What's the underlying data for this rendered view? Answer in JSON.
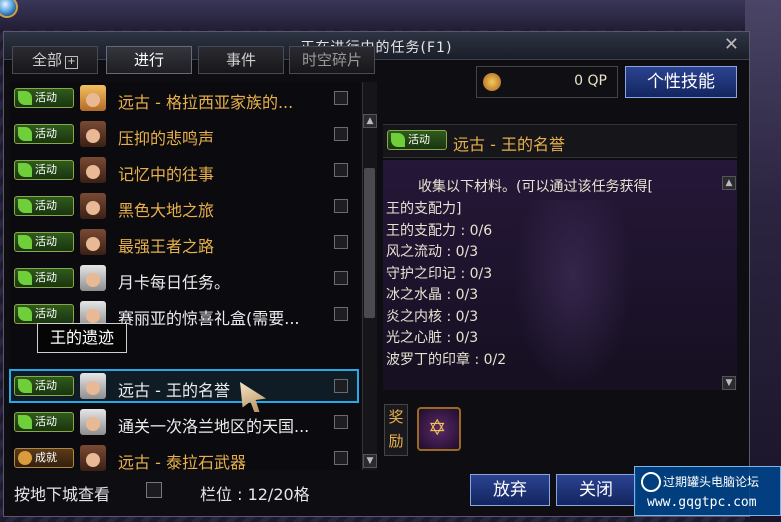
{
  "window": {
    "title": "正在进行中的任务(F1)",
    "close_icon": "close-icon"
  },
  "tabs": [
    {
      "label": "全部",
      "icon": "plus-box-icon"
    },
    {
      "label": "进行",
      "active": true
    },
    {
      "label": "事件"
    },
    {
      "label": "时空碎片"
    }
  ],
  "qp": {
    "value": "0 QP",
    "icon": "qp-coin-icon"
  },
  "skill_button": "个性技能",
  "quests": [
    {
      "badge": "活动",
      "avatar": "female",
      "title": "远古 - 格拉西亚家族的...",
      "color": "#e8b04a"
    },
    {
      "badge": "活动",
      "avatar": "male",
      "title": "压抑的悲鸣声",
      "color": "#e8b04a"
    },
    {
      "badge": "活动",
      "avatar": "male",
      "title": "记忆中的往事",
      "color": "#e8b04a"
    },
    {
      "badge": "活动",
      "avatar": "male",
      "title": "黑色大地之旅",
      "color": "#e8b04a"
    },
    {
      "badge": "活动",
      "avatar": "male",
      "title": "最强王者之路",
      "color": "#e8b04a"
    },
    {
      "badge": "活动",
      "avatar": "silver",
      "title": "月卡每日任务。",
      "color": "#ececec"
    },
    {
      "badge": "活动",
      "avatar": "silver",
      "title": "赛丽亚的惊喜礼盒(需要...",
      "color": "#ececec"
    },
    {
      "badge": "活动",
      "avatar": "silver",
      "title": "远古 - 王的名誉",
      "color": "#ececec",
      "selected": true
    },
    {
      "badge": "活动",
      "avatar": "silver",
      "title": "通关一次洛兰地区的天国...",
      "color": "#ececec"
    },
    {
      "badge": "成就",
      "avatar": "male",
      "title": "远古 - 泰拉石武器",
      "color": "#e8b04a"
    }
  ],
  "tooltip": "王的遗迹",
  "detail": {
    "badge": "活动",
    "title": "远古 - 王的名誉",
    "intro": "收集以下材料。(可以通过该任务获得[",
    "lines": [
      "王的支配力]",
      "王的支配力 : 0/6",
      "风之流动 : 0/3",
      "守护之印记 : 0/3",
      "冰之水晶 : 0/3",
      "炎之内核 : 0/3",
      "光之心脏 : 0/3",
      "波罗丁的印章 : 0/2"
    ]
  },
  "reward": {
    "label": "奖励",
    "icon": "star-emblem-icon"
  },
  "bottom": {
    "dungeon_check_label": "按地下城查看",
    "slots_label": "栏位 : 12/20格",
    "abandon_button": "放弃",
    "close_button": "关闭"
  },
  "watermark": {
    "title": "过期罐头电脑论坛",
    "url": "www.gqgtpc.com"
  }
}
